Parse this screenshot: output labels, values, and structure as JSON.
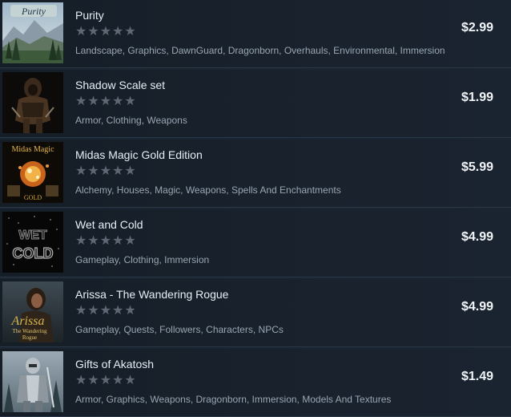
{
  "items": [
    {
      "title": "Purity",
      "rating_stars": "★★★★★",
      "tags": "Landscape, Graphics, DawnGuard, Dragonborn, Overhauls, Environmental, Immersion",
      "price": "$2.99",
      "thumb_text": "Purity"
    },
    {
      "title": "Shadow Scale set",
      "rating_stars": "★★★★★",
      "tags": "Armor, Clothing, Weapons",
      "price": "$1.99"
    },
    {
      "title": "Midas Magic Gold Edition",
      "rating_stars": "★★★★★",
      "tags": "Alchemy, Houses, Magic, Weapons, Spells And Enchantments",
      "price": "$5.99",
      "thumb_text": "Midas Magic",
      "thumb_sub": "GOLD"
    },
    {
      "title": "Wet and Cold",
      "rating_stars": "★★★★★",
      "tags": "Gameplay, Clothing, Immersion",
      "price": "$4.99",
      "thumb_text": "WET",
      "thumb_sub": "COLD"
    },
    {
      "title": "Arissa - The Wandering Rogue",
      "rating_stars": "★★★★★",
      "tags": "Gameplay, Quests, Followers, Characters, NPCs",
      "price": "$4.99",
      "thumb_text": "Arissa",
      "thumb_sub": "The Wandering",
      "thumb_sub2": "Rogue"
    },
    {
      "title": "Gifts of Akatosh",
      "rating_stars": "★★★★★",
      "tags": "Armor, Graphics, Weapons, Dragonborn, Immersion, Models And Textures",
      "price": "$1.49"
    }
  ]
}
